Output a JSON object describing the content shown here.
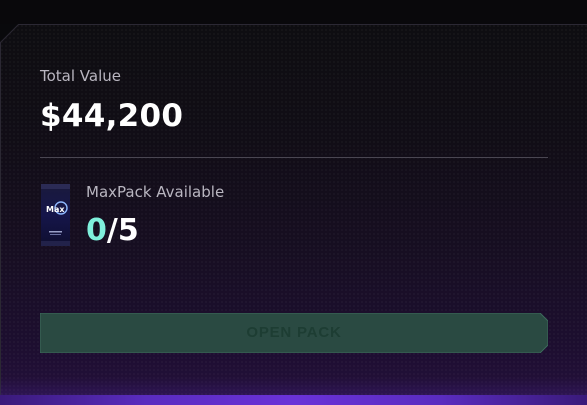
{
  "summary": {
    "total_value_label": "Total Value",
    "total_value": "$44,200"
  },
  "pack": {
    "available_label": "MaxPack Available",
    "available_count": "0",
    "separator": "/",
    "max_count": "5",
    "thumbnail_text": "Max"
  },
  "actions": {
    "open_pack_label": "OPEN PACK",
    "open_pack_disabled": true
  },
  "colors": {
    "accent_teal": "#7ff0dc",
    "button_fill": "#2a4a42",
    "button_text": "#1d3d33",
    "glow_purple": "#6a32d8"
  }
}
